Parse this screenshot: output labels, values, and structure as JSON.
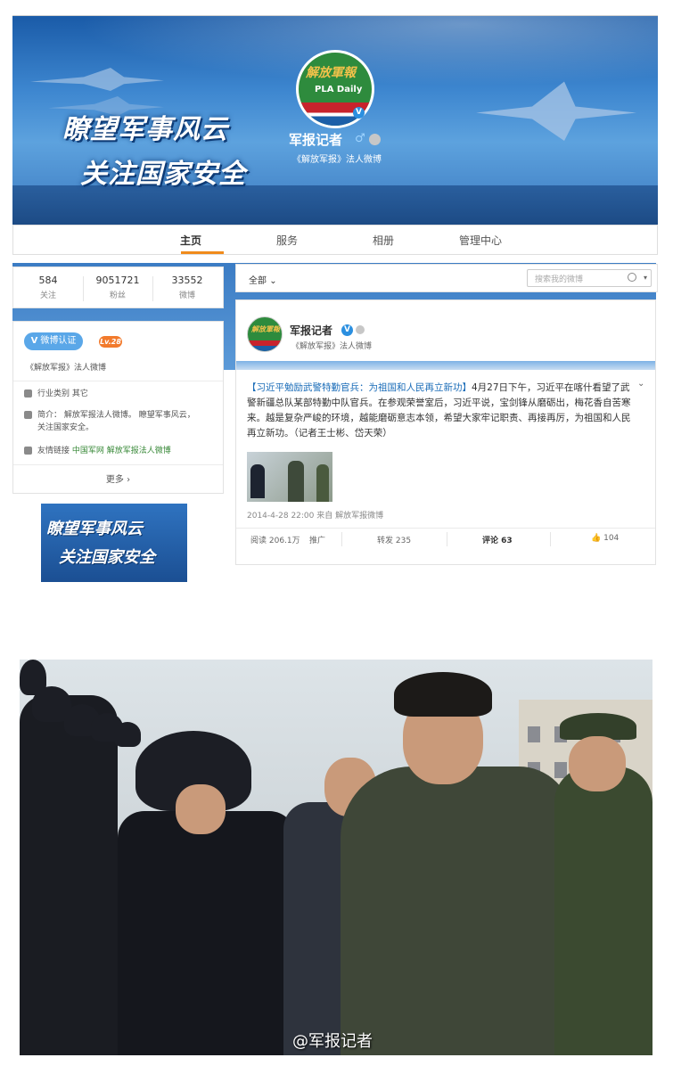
{
  "banner": {
    "slogan_line1": "瞭望军事风云",
    "slogan_line2": "关注国家安全",
    "logo_calligraphy": "解放軍報",
    "logo_text": "PLA Daily",
    "profile_name": "军报记者",
    "gender_symbol": "♂",
    "profile_desc": "《解放军报》法人微博"
  },
  "nav": {
    "items": [
      "主页",
      "服务",
      "相册",
      "管理中心"
    ],
    "active": "主页"
  },
  "stats": [
    {
      "value": "584",
      "label": "关注"
    },
    {
      "value": "9051721",
      "label": "粉丝"
    },
    {
      "value": "33552",
      "label": "微博"
    }
  ],
  "info": {
    "verify_label": "微博认证",
    "level_label": "Lv.28",
    "verify_desc": "《解放军报》法人微博",
    "category": "行业类别 其它",
    "intro_line1": "简介： 解放军报法人微博。 瞭望军事风云，",
    "intro_line2": "关注国家安全。",
    "links_label": "友情链接",
    "links": "中国军网 解放军报法人微博",
    "more": "更多 ›"
  },
  "mini_banner": {
    "line1": "瞭望军事风云",
    "line2": "关注国家安全"
  },
  "filter": {
    "all_label": "全部",
    "search_placeholder": "搜索我的微博"
  },
  "post": {
    "author": "军报记者",
    "author_desc": "《解放军报》法人微博",
    "avatar_text": "解放軍報",
    "body_link": "【习近平勉励武警特勤官兵：为祖国和人民再立新功】",
    "body_text": "4月27日下午，习近平在喀什看望了武警新疆总队某部特勤中队官兵。在参观荣誉室后，习近平说，宝剑锋从磨砺出，梅花香自苦寒来。越是复杂严峻的环境，越能磨砺意志本领，希望大家牢记职责、再接再厉，为祖国和人民再立新功。（记者王士彬、岱天荣）",
    "time": "2014-4-28 22:00 来自 解放军报微博",
    "reads": "阅读 206.1万",
    "promote": "推广",
    "reposts": "转发 235",
    "comments": "评论 63",
    "likes": "104"
  },
  "photo": {
    "watermark": "@军报记者"
  }
}
